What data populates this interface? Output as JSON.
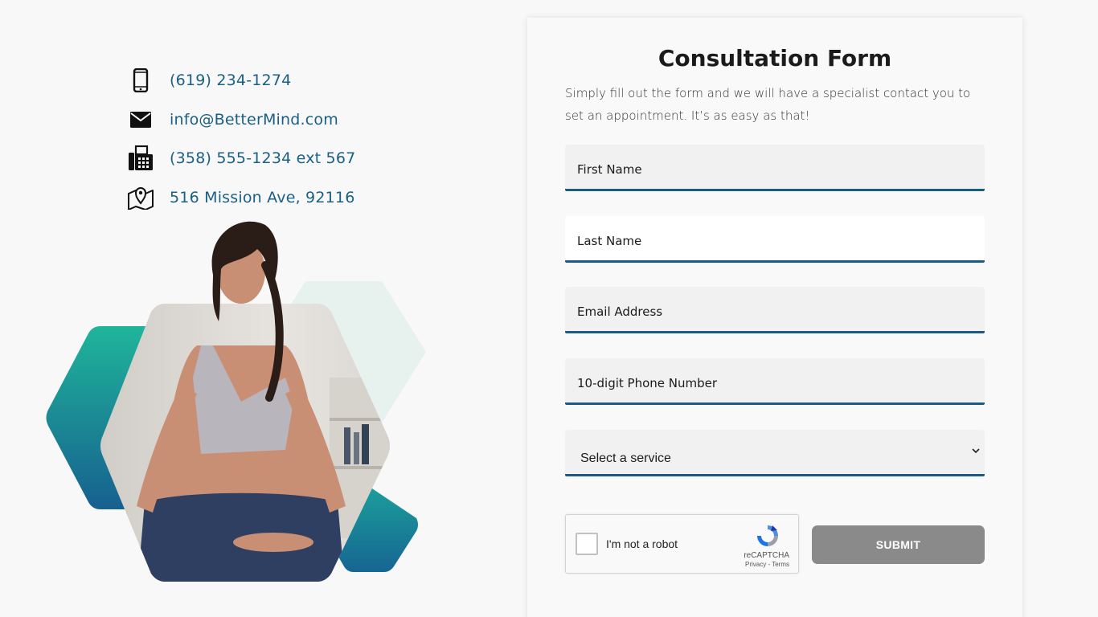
{
  "contact": {
    "phone": "(619) 234-1274",
    "email": "info@BetterMind.com",
    "fax": "(358) 555-1234 ext 567",
    "address": "516 Mission Ave, 92116"
  },
  "icons": {
    "phone": "mobile-phone-icon",
    "email": "envelope-icon",
    "fax": "fax-machine-icon",
    "address": "map-pin-icon"
  },
  "colors": {
    "link": "#1a5f85",
    "accent": "#1a5a85",
    "teal": "#1fb59a",
    "submit": "#8a8a8a"
  },
  "form": {
    "title": "Consultation Form",
    "description": "Simply fill out the form and we will have a specialist contact you to set an appointment. It’s as easy as that!",
    "fields": {
      "first_name": "First Name",
      "last_name": "Last Name",
      "email": "Email Address",
      "phone": "10-digit Phone Number"
    },
    "service_select": "Select a service",
    "recaptcha": {
      "label": "I'm not a robot",
      "brand": "reCAPTCHA",
      "terms": "Privacy - Terms"
    },
    "submit_label": "SUBMIT"
  }
}
